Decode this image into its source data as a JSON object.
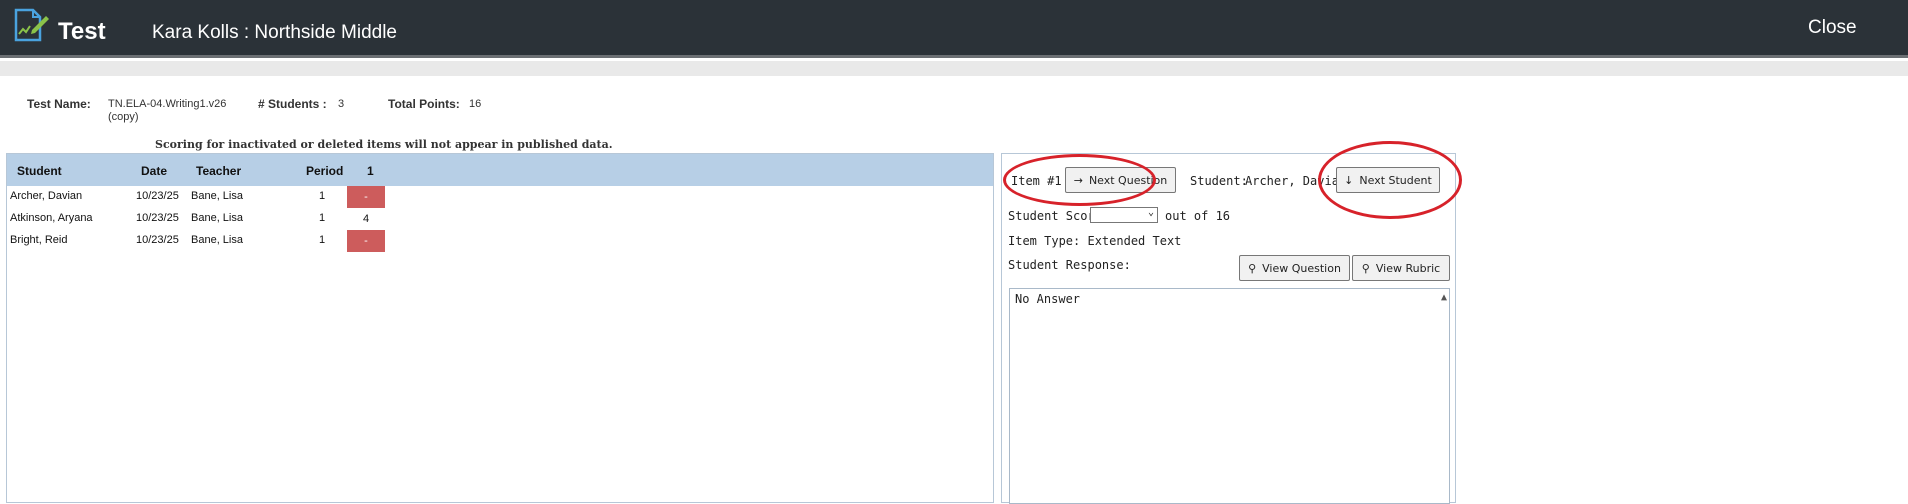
{
  "header": {
    "app_title": "Test",
    "context": "Kara Kolls : Northside Middle",
    "close_label": "Close"
  },
  "test_info": {
    "test_name_label": "Test Name:",
    "test_name_line1": "TN.ELA-04.Writing1.v26",
    "test_name_line2": "(copy)",
    "students_label": "# Students :",
    "students_value": "3",
    "points_label": "Total Points:",
    "points_value": "16"
  },
  "notice": "Scoring for inactivated or deleted items will not appear in published data.",
  "grid": {
    "columns": [
      "Student",
      "Date",
      "Teacher",
      "Period",
      "1"
    ],
    "rows": [
      {
        "student": "Archer, Davian",
        "date": "10/23/25",
        "teacher": "Bane, Lisa",
        "period": "1",
        "score": "-"
      },
      {
        "student": "Atkinson, Aryana",
        "date": "10/23/25",
        "teacher": "Bane, Lisa",
        "period": "1",
        "score": "4"
      },
      {
        "student": "Bright, Reid",
        "date": "10/23/25",
        "teacher": "Bane, Lisa",
        "period": "1",
        "score": "-"
      }
    ]
  },
  "panel": {
    "item_label": "Item #1",
    "next_question": "Next Question",
    "student_label": "Student:",
    "student_name": "Archer, Davian",
    "next_student": "Next Student",
    "score_label": "Student Score",
    "score_value": "",
    "out_of": "out of 16",
    "item_type": "Item Type: Extended Text",
    "response_label": "Student Response:",
    "view_question": "View Question",
    "view_rubric": "View Rubric",
    "response_text": "No Answer"
  },
  "colors": {
    "topbar": "#2b3238",
    "grid_header": "#b7cfe6",
    "ungraded_cell": "#cd5c5c",
    "annotation": "#d7222a"
  }
}
